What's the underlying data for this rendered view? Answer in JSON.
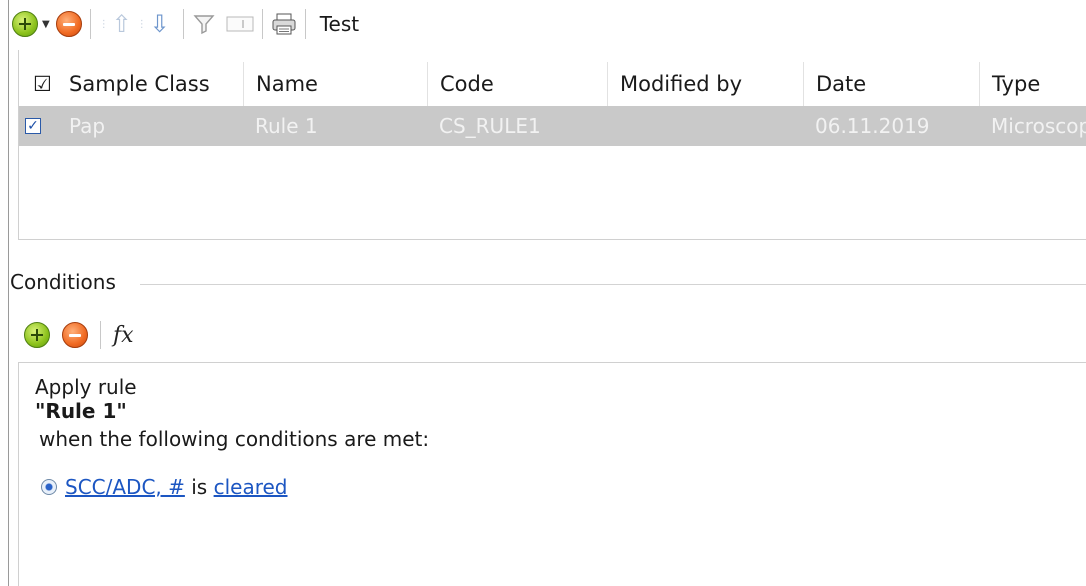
{
  "toolbar": {
    "add_icon": "add-green-icon",
    "remove_icon": "remove-red-icon",
    "move_up_icon": "arrow-up-icon",
    "move_down_icon": "arrow-down-icon",
    "filter_icon": "filter-icon",
    "field_icon": "field-icon",
    "print_icon": "print-icon",
    "title": "Test"
  },
  "grid": {
    "columns": [
      {
        "key": "check",
        "label": "☑"
      },
      {
        "key": "sample_class",
        "label": "Sample Class"
      },
      {
        "key": "name",
        "label": "Name"
      },
      {
        "key": "code",
        "label": "Code"
      },
      {
        "key": "modified_by",
        "label": "Modified by"
      },
      {
        "key": "date",
        "label": "Date"
      },
      {
        "key": "type",
        "label": "Type"
      }
    ],
    "rows": [
      {
        "checked": true,
        "sample_class": "Pap",
        "name": "Rule 1",
        "code": "CS_RULE1",
        "modified_by": "",
        "date": "06.11.2019",
        "type": "Microscopy"
      }
    ]
  },
  "conditions": {
    "title": "Conditions",
    "fx_label": "fx",
    "line1": "Apply rule",
    "rule_name": "\"Rule 1\"",
    "line3": "when the following conditions are met:",
    "condition": {
      "field": "SCC/ADC, #",
      "operator": "is",
      "value": "cleared"
    }
  },
  "colors": {
    "selected_row": "#c9c9c9",
    "link": "#1c56c2"
  }
}
